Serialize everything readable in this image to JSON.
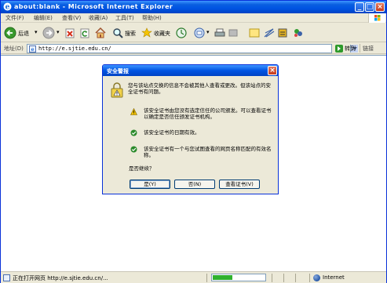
{
  "window": {
    "title": "about:blank - Microsoft Internet Explorer",
    "controls": {
      "minimize": "_",
      "maximize": "□",
      "close": "×"
    }
  },
  "menubar": {
    "items": [
      "文件(F)",
      "编辑(E)",
      "查看(V)",
      "收藏(A)",
      "工具(T)",
      "帮助(H)"
    ]
  },
  "toolbar": {
    "back_label": "后退",
    "search_label": "搜索",
    "favorites_label": "收藏夹"
  },
  "addressbar": {
    "label": "地址(D)",
    "url": "http://e.sjtie.edu.cn/",
    "go_label": "转到",
    "links_label": "链接"
  },
  "statusbar": {
    "text": "正在打开网页 http://e.sjtie.edu.cn/...",
    "progress": 0.38,
    "zone": "Internet"
  },
  "dialog": {
    "title": "安全警报",
    "intro": "您与该站点交换的信息不会被其他人查看或更改。但该站点的安全证书有问题。",
    "items": [
      {
        "icon": "warning-icon",
        "text": "该安全证书由您没有选定信任的公司颁发。可以查看证书以确定是否信任颁发证书机构。"
      },
      {
        "icon": "check-icon",
        "text": "该安全证书的日期有效。"
      },
      {
        "icon": "check-icon",
        "text": "该安全证书有一个与您试图查看的网页名称匹配的有效名称。"
      }
    ],
    "question": "是否继续？",
    "buttons": {
      "yes": "是(Y)",
      "no": "否(N)",
      "view": "查看证书(V)"
    }
  },
  "colors": {
    "titlebar": "#0054e3",
    "dialog_bg": "#ece9d8",
    "warning": "#f2c200",
    "check": "#2a8a2a"
  }
}
